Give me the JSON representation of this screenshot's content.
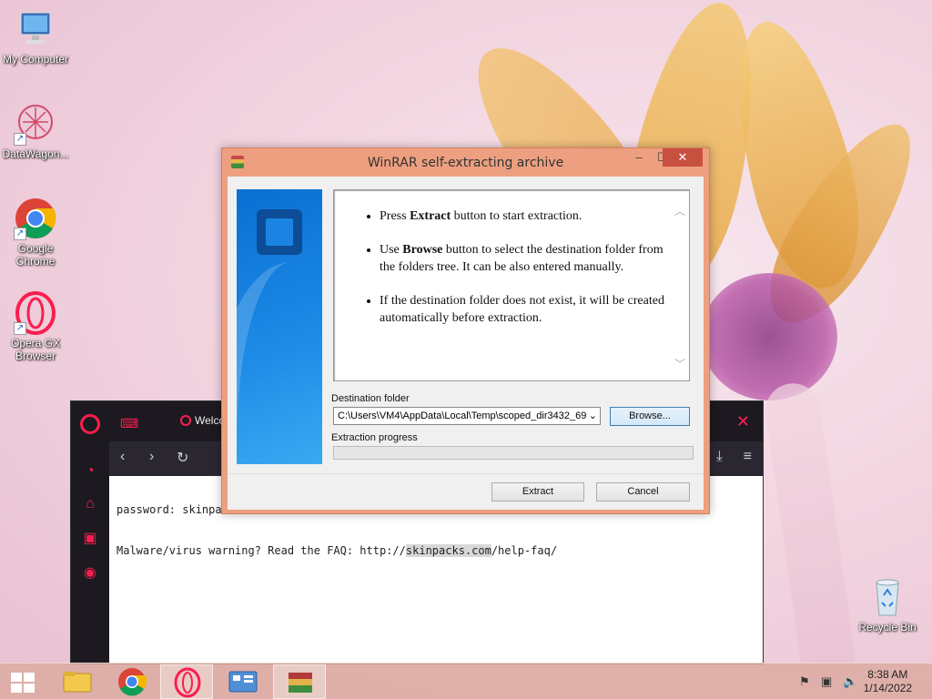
{
  "desktop": {
    "icons": [
      {
        "label": "My Computer"
      },
      {
        "label": "DataWagon..."
      },
      {
        "label": "Google Chrome"
      },
      {
        "label": "Opera GX Browser"
      },
      {
        "label": "Recycle Bin"
      }
    ]
  },
  "browser": {
    "tab_title": "Welcome t",
    "lines": [
      "password: skinpa",
      "Malware/virus warning? Read the FAQ: http://"
    ],
    "link_highlight": "skinpacks.com",
    "link_tail": "/help-faq/"
  },
  "dialog": {
    "title": "WinRAR self-extracting archive",
    "info": [
      {
        "pre": "Press ",
        "bold": "Extract",
        "post": " button to start extraction."
      },
      {
        "pre": "Use ",
        "bold": "Browse",
        "post": " button to select the destination folder from the folders tree. It can be also entered manually."
      },
      {
        "pre": "",
        "bold": "",
        "post": "If the destination folder does not exist, it will be created automatically before extraction."
      }
    ],
    "destination_label": "Destination folder",
    "destination_value": "C:\\Users\\VM4\\AppData\\Local\\Temp\\scoped_dir3432_69",
    "browse_label": "Browse...",
    "progress_label": "Extraction progress",
    "progress_value": 0,
    "extract_label": "Extract",
    "cancel_label": "Cancel"
  },
  "taskbar": {
    "time": "8:38 AM",
    "date": "1/14/2022"
  },
  "colors": {
    "dialog_frame": "#ed9f7f",
    "close_button": "#c7503f",
    "opera_red": "#fa1e4e"
  }
}
